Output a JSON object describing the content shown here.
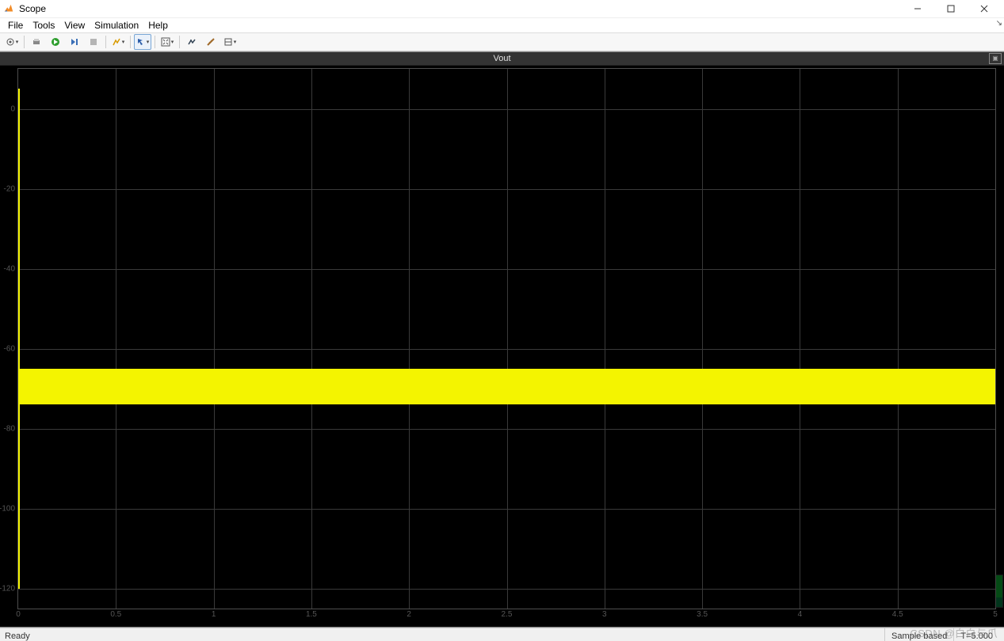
{
  "window": {
    "title": "Scope"
  },
  "menu": {
    "file": "File",
    "tools": "Tools",
    "view": "View",
    "simulation": "Simulation",
    "help": "Help"
  },
  "plot": {
    "title": "Vout"
  },
  "status": {
    "ready": "Ready",
    "mode": "Sample based",
    "time": "T=5.000"
  },
  "watermark": "CSDN @白白与爪",
  "chart_data": {
    "type": "line",
    "title": "Vout",
    "xlabel": "",
    "ylabel": "",
    "xlim": [
      0,
      5
    ],
    "ylim": [
      -125,
      10
    ],
    "xticks": [
      0,
      0.5,
      1,
      1.5,
      2,
      2.5,
      3,
      3.5,
      4,
      4.5,
      5
    ],
    "yticks": [
      0,
      -20,
      -40,
      -60,
      -80,
      -100,
      -120
    ],
    "series": [
      {
        "name": "Vout",
        "color": "#f4f400",
        "envelope": {
          "ymin": -74,
          "ymax": -65
        },
        "note": "High-frequency signal oscillating densely between approx -74 and -65 across full 0..5 time range; appears as a solid yellow band."
      }
    ]
  }
}
